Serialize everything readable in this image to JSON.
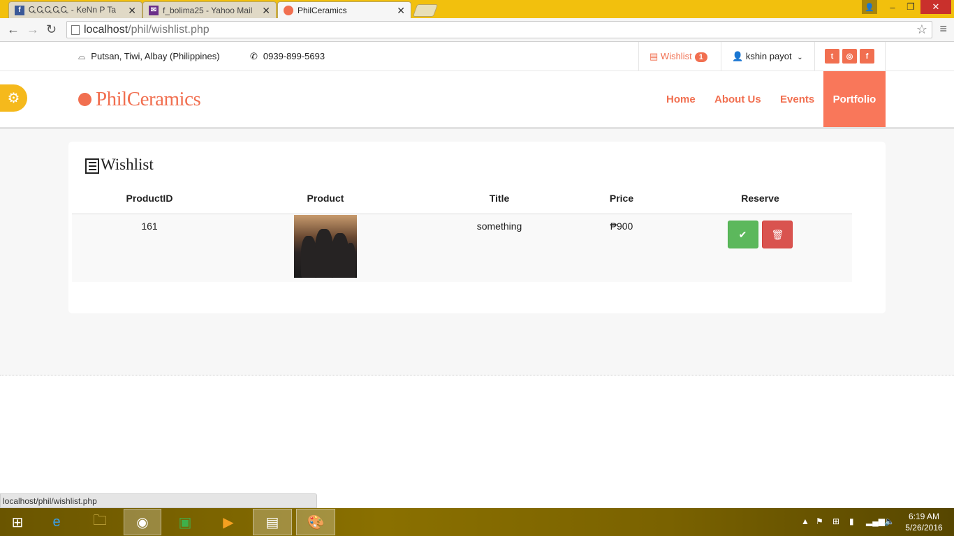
{
  "browser": {
    "tabs": [
      {
        "title": "ᏩᏩᏩᏩᏩ - KeNn P Ta",
        "favicon": "facebook-icon",
        "active": false
      },
      {
        "title": "f_bolima25 - Yahoo Mail",
        "favicon": "mail-icon",
        "active": false
      },
      {
        "title": "PhilCeramics",
        "favicon": "site-dot-icon",
        "active": true
      }
    ],
    "url_host": "localhost",
    "url_path": "/phil/wishlist.php",
    "status_url": "localhost/phil/wishlist.php"
  },
  "site": {
    "address": "Putsan, Tiwi, Albay (Philippines)",
    "phone": "0939-899-5693",
    "wishlist_label": "Wishlist",
    "wishlist_count": "1",
    "username": "kshin payot",
    "brand": "PhilCeramics",
    "accent": "#f16f50",
    "nav": [
      {
        "label": "Home"
      },
      {
        "label": "About Us"
      },
      {
        "label": "Events"
      },
      {
        "label": "Portfolio",
        "active": true
      }
    ],
    "social": [
      "twitter-icon",
      "instagram-icon",
      "facebook-icon"
    ]
  },
  "wishlist": {
    "title": "Wishlist",
    "columns": [
      "ProductID",
      "Product",
      "Title",
      "Price",
      "Reserve"
    ],
    "rows": [
      {
        "product_id": "161",
        "title": "something",
        "price": "₱900"
      }
    ]
  },
  "taskbar": {
    "time": "6:19 AM",
    "date": "5/26/2016"
  }
}
